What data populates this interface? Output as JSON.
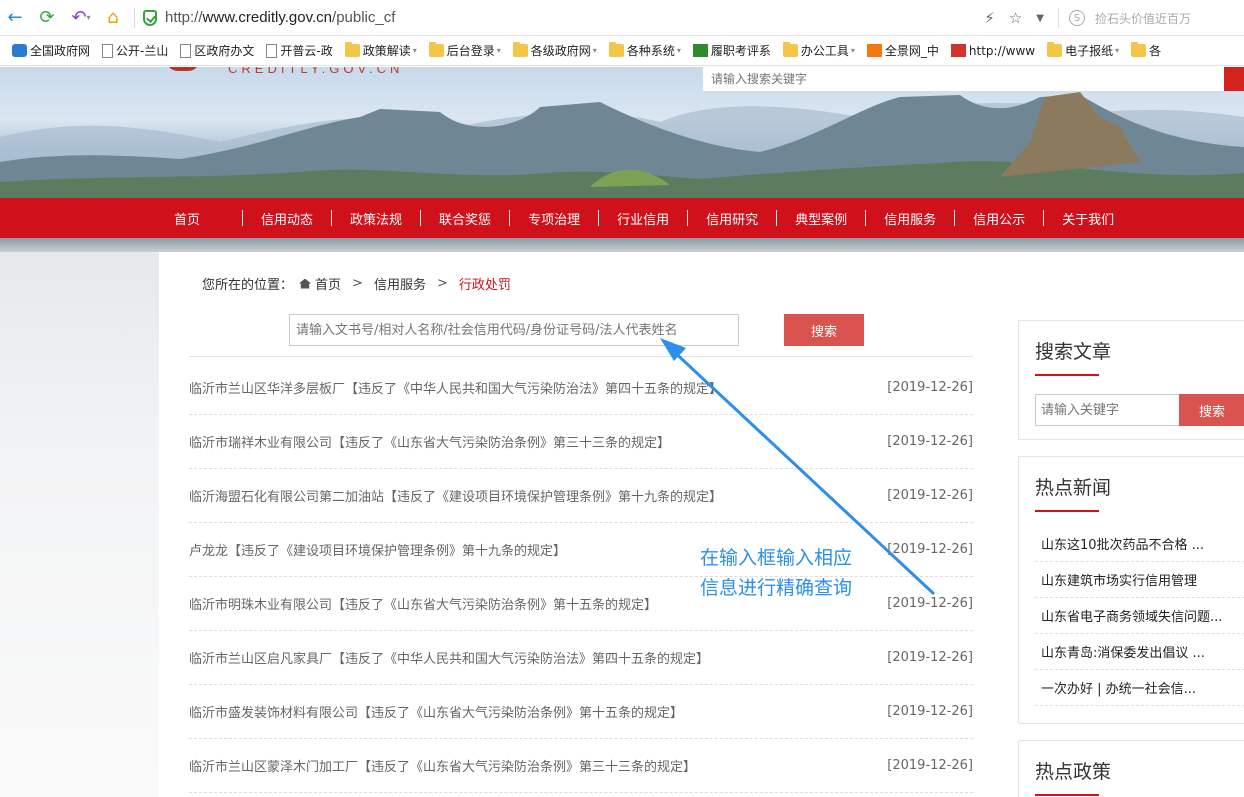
{
  "browser": {
    "url_prefix": "http://",
    "url_domain": "www.creditly.gov.cn",
    "url_path": "/public_cf",
    "search_placeholder": "捡石头价值近百万",
    "bookmarks": [
      {
        "label": "全国政府网",
        "icon": "gov"
      },
      {
        "label": "公开-兰山",
        "icon": "page"
      },
      {
        "label": "区政府办文",
        "icon": "page"
      },
      {
        "label": "开普云-政",
        "icon": "page"
      },
      {
        "label": "政策解读",
        "icon": "folder",
        "dropdown": true
      },
      {
        "label": "后台登录",
        "icon": "folder",
        "dropdown": true
      },
      {
        "label": "各级政府网",
        "icon": "folder",
        "dropdown": true
      },
      {
        "label": "各种系统",
        "icon": "folder",
        "dropdown": true
      },
      {
        "label": "履职考评系",
        "icon": "green"
      },
      {
        "label": "办公工具",
        "icon": "folder",
        "dropdown": true
      },
      {
        "label": "全景网_中",
        "icon": "orange"
      },
      {
        "label": "http://www",
        "icon": "red"
      },
      {
        "label": "电子报纸",
        "icon": "folder",
        "dropdown": true
      },
      {
        "label": "各",
        "icon": "folder"
      }
    ]
  },
  "site": {
    "logo_text": "CREDITLY.GOV.CN",
    "top_search_placeholder": "请输入搜索关键字",
    "nav": [
      "首页",
      "信用动态",
      "政策法规",
      "联合奖惩",
      "专项治理",
      "行业信用",
      "信用研究",
      "典型案例",
      "信用服务",
      "信用公示",
      "关于我们"
    ],
    "breadcrumb": {
      "prefix": "您所在的位置：",
      "home": "首页",
      "sep": ">",
      "level1": "信用服务",
      "current": "行政处罚"
    },
    "search": {
      "placeholder": "请输入文书号/相对人名称/社会信用代码/身份证号码/法人代表姓名",
      "button": "搜索"
    },
    "records": [
      {
        "title": "临沂市兰山区华洋多层板厂【违反了《中华人民共和国大气污染防治法》第四十五条的规定】",
        "date": "[2019-12-26]"
      },
      {
        "title": "临沂市瑞祥木业有限公司【违反了《山东省大气污染防治条例》第三十三条的规定】",
        "date": "[2019-12-26]"
      },
      {
        "title": "临沂海盟石化有限公司第二加油站【违反了《建设项目环境保护管理条例》第十九条的规定】",
        "date": "[2019-12-26]"
      },
      {
        "title": "卢龙龙【违反了《建设项目环境保护管理条例》第十九条的规定】",
        "date": "[2019-12-26]"
      },
      {
        "title": "临沂市明珠木业有限公司【违反了《山东省大气污染防治条例》第十五条的规定】",
        "date": "[2019-12-26]"
      },
      {
        "title": "临沂市兰山区启凡家具厂【违反了《中华人民共和国大气污染防治法》第四十五条的规定】",
        "date": "[2019-12-26]"
      },
      {
        "title": "临沂市盛发装饰材料有限公司【违反了《山东省大气污染防治条例》第十五条的规定】",
        "date": "[2019-12-26]"
      },
      {
        "title": "临沂市兰山区蒙泽木门加工厂【违反了《山东省大气污染防治条例》第三十三条的规定】",
        "date": "[2019-12-26]"
      }
    ],
    "sidebar": {
      "search_title": "搜索文章",
      "search_placeholder": "请输入关键字",
      "search_button": "搜索",
      "hot_news_title": "热点新闻",
      "hot_news": [
        "山东这10批次药品不合格 ...",
        "山东建筑市场实行信用管理",
        "山东省电子商务领域失信问题...",
        "山东青岛:消保委发出倡议 ...",
        "一次办好 | 办统一社会信..."
      ],
      "hot_policy_title": "热点政策"
    },
    "annotation": {
      "line1": "在输入框输入相应",
      "line2": "信息进行精确查询",
      "color": "#2c8fe9"
    },
    "colors": {
      "nav_red": "#d0101b",
      "button_red": "#d9534f"
    }
  }
}
